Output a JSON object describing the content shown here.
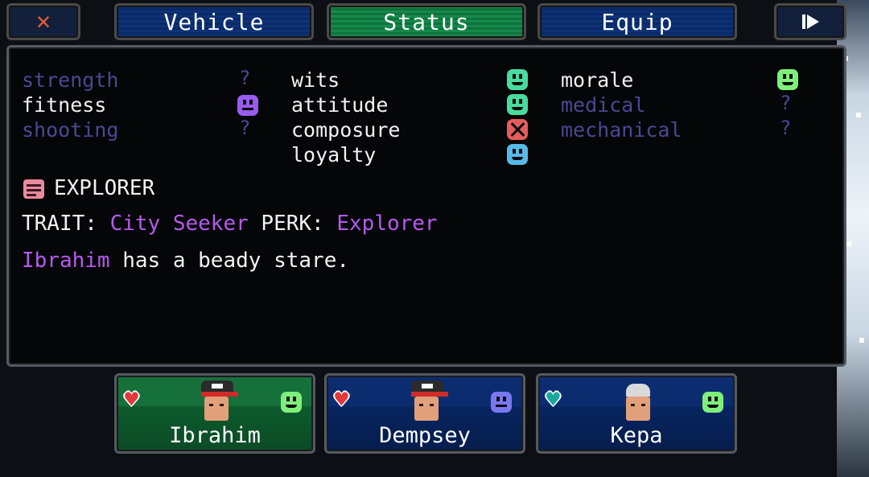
{
  "topbar": {
    "close_label": "✕",
    "tabs": [
      {
        "label": "Vehicle",
        "active": false
      },
      {
        "label": "Status",
        "active": true
      },
      {
        "label": "Equip",
        "active": false
      }
    ],
    "next_icon": "play-next-icon"
  },
  "stats": {
    "col1": [
      {
        "name": "strength",
        "known": false,
        "value": "?"
      },
      {
        "name": "fitness",
        "known": true,
        "mood": "neutral"
      },
      {
        "name": "shooting",
        "known": false,
        "value": "?"
      }
    ],
    "col2": [
      {
        "name": "wits",
        "known": true,
        "mood": "happy"
      },
      {
        "name": "attitude",
        "known": true,
        "mood": "happy"
      },
      {
        "name": "composure",
        "known": true,
        "mood": "bad"
      },
      {
        "name": "loyalty",
        "known": true,
        "mood": "happy"
      }
    ],
    "col3": [
      {
        "name": "morale",
        "known": true,
        "mood": "happy"
      },
      {
        "name": "medical",
        "known": false,
        "value": "?"
      },
      {
        "name": "mechanical",
        "known": false,
        "value": "?"
      }
    ]
  },
  "profile": {
    "role": "EXPLORER",
    "trait_label": "TRAIT:",
    "trait": "City Seeker",
    "perk_label": "PERK:",
    "perk": "Explorer",
    "name": "Ibrahim",
    "description": "has a beady stare."
  },
  "party": [
    {
      "name": "Ibrahim",
      "selected": true,
      "mood": "happy"
    },
    {
      "name": "Dempsey",
      "selected": false,
      "mood": "neutral"
    },
    {
      "name": "Kepa",
      "selected": false,
      "mood": "happy"
    }
  ],
  "colors": {
    "tab_blue": "#0d3278",
    "tab_green": "#158a4a",
    "happy_green": "#7ef07a",
    "happy_teal": "#48dba0",
    "happy_blue": "#58b8e8",
    "neutral_purple": "#9a5cf0",
    "neutral_blue": "#7a78f0",
    "bad_red": "#e45d5d",
    "unknown_stat": "#4a4893",
    "highlight_purple": "#b659ee"
  }
}
